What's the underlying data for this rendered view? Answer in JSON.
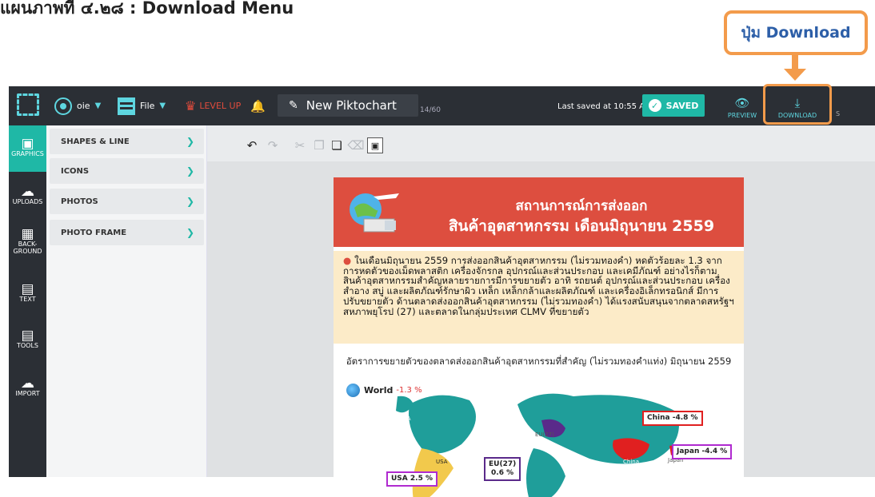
{
  "caption": "แผนภาพที่ ๔.๒๘ : Download Menu",
  "callout": "ปุ่ม Download",
  "topbar": {
    "user": "oie",
    "file": "File",
    "levelup": "LEVEL UP",
    "doc_title": "New Piktochart",
    "counter": "14/60",
    "last_saved": "Last saved at 10:55 AM",
    "saved": "SAVED",
    "preview": "PREVIEW",
    "download": "DOWNLOAD",
    "more": "S"
  },
  "rail": [
    {
      "label": "GRAPHICS",
      "icon": "image-icon"
    },
    {
      "label": "UPLOADS",
      "icon": "cloud-upload-icon"
    },
    {
      "label": "BACK-\nGROUND",
      "icon": "background-icon"
    },
    {
      "label": "TEXT",
      "icon": "text-icon"
    },
    {
      "label": "TOOLS",
      "icon": "tools-icon"
    },
    {
      "label": "IMPORT",
      "icon": "cloud-import-icon"
    }
  ],
  "panel": [
    "SHAPES & LINE",
    "ICONS",
    "PHOTOS",
    "PHOTO FRAME"
  ],
  "poster": {
    "title1": "สถานการณ์การส่งออก",
    "title2": "สินค้าอุตสาหกรรม เดือนมิถุนายน 2559",
    "body": "ในเดือนมิถุนายน 2559 การส่งออกสินค้าอุตสาหกรรม (ไม่รวมทองคำ) หดตัวร้อยละ 1.3 จากการหดตัวของเม็ดพลาสติก เครื่องจักรกล อุปกรณ์และส่วนประกอบ และเคมีภัณฑ์ อย่างไรก็ตาม สินค้าอุตสาหกรรมสำคัญหลายรายการมีการขยายตัว อาทิ รถยนต์ อุปกรณ์และส่วนประกอบ เครื่องสำอาง สบู่ และผลิตภัณฑ์รักษาผิว เหล็ก เหล็กกล้าและผลิตภัณฑ์ และเครื่องอิเล็กทรอนิกส์ มีการปรับขยายตัว ด้านตลาดส่งออกสินค้าอุตสาหกรรม (ไม่รวมทองคำ) ได้แรงสนับสนุนจากตลาดสหรัฐฯ สหภาพยุโรป (27) และตลาดในกลุ่มประเทศ CLMV ที่ขยายตัว",
    "map_title": "อัตราการขยายตัวของตลาดส่งออกสินค้าอุตสาหกรรมที่สำคัญ (ไม่รวมทองคำแท่ง) มิถุนายน 2559",
    "world": "World",
    "world_val": "-1.3 %",
    "china": "China -4.8 %",
    "japan": "Japan  -4.4 %",
    "eu": "EU(27)\n0.6 %",
    "usa": "USA  2.5 %",
    "usa_map": "USA",
    "usa_map2": "USA",
    "eu_map": "EU(27)",
    "china_map": "China",
    "japan_map": "Japan"
  },
  "colors": {
    "accent": "#1fb8a6",
    "highlight": "#f39b4b",
    "header": "#dd4e3f",
    "dark": "#2b2f35"
  }
}
